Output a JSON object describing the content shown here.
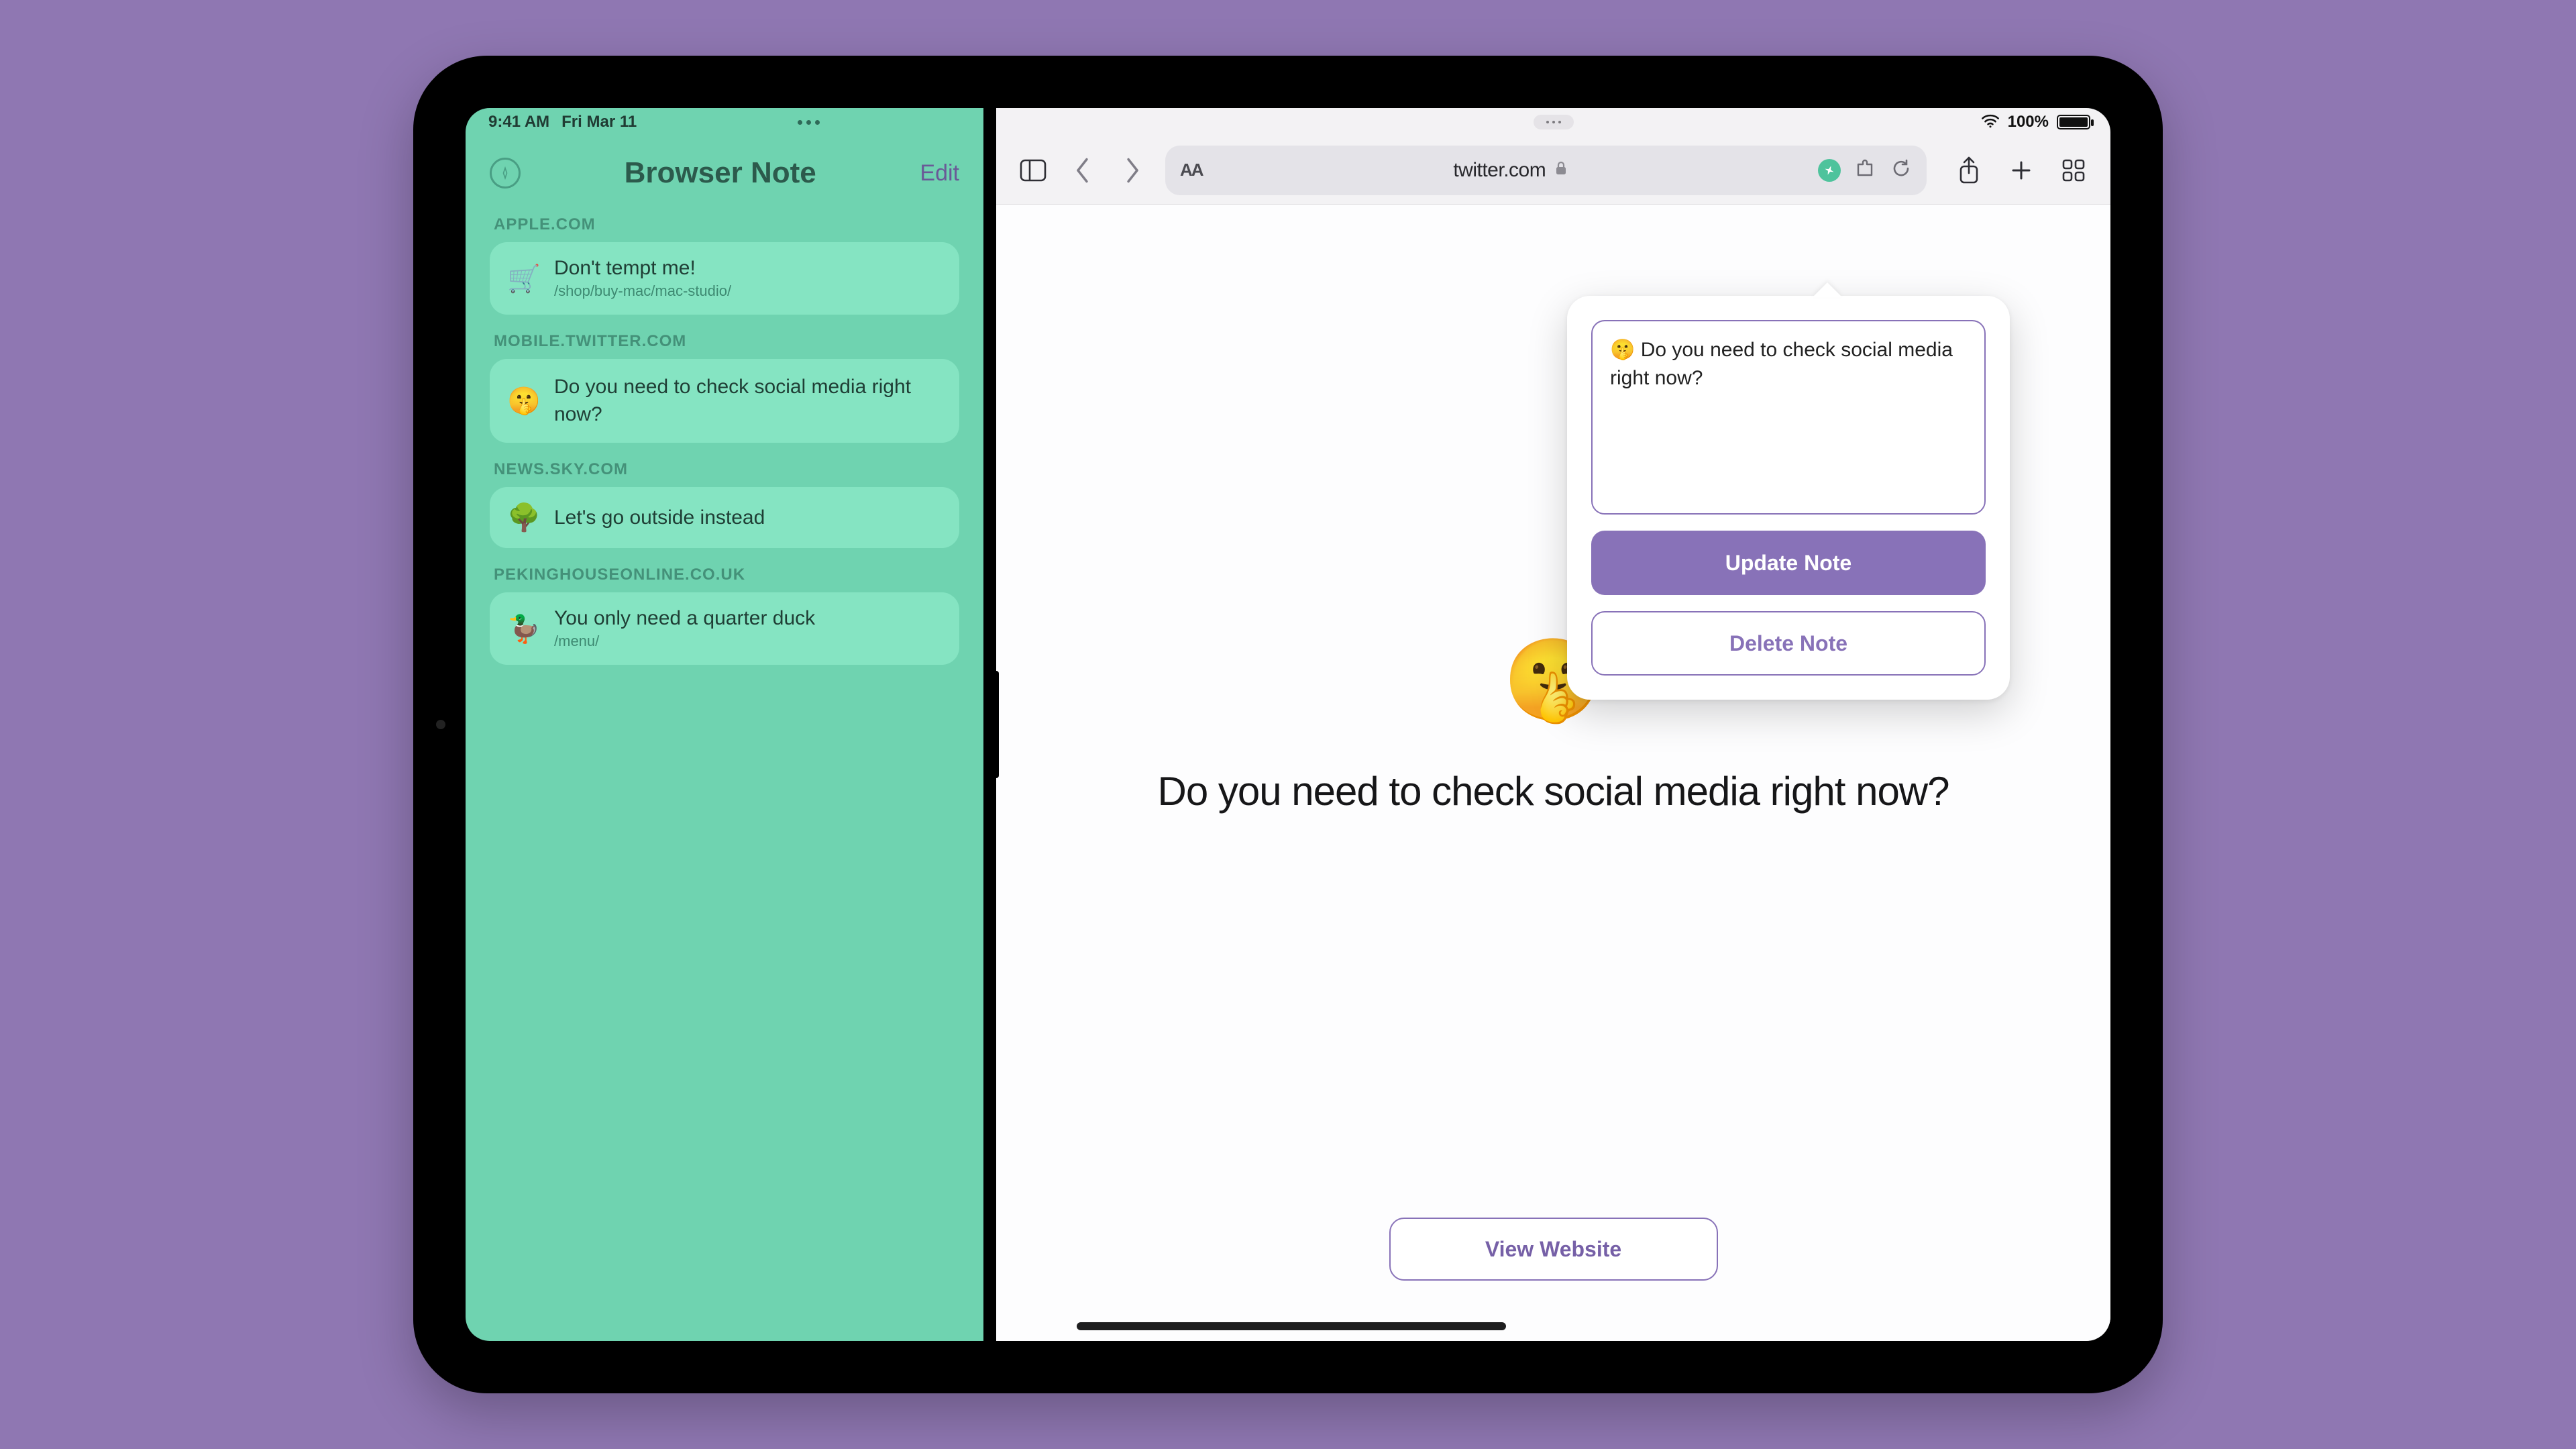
{
  "status": {
    "time": "9:41 AM",
    "date": "Fri Mar 11",
    "battery": "100%"
  },
  "left": {
    "title": "Browser Note",
    "edit_label": "Edit",
    "groups": [
      {
        "domain": "APPLE.COM",
        "emoji": "🛒",
        "title": "Don't tempt me!",
        "path": "/shop/buy-mac/mac-studio/"
      },
      {
        "domain": "MOBILE.TWITTER.COM",
        "emoji": "🤫",
        "title": "Do you need to check social media right now?",
        "path": ""
      },
      {
        "domain": "NEWS.SKY.COM",
        "emoji": "🌳",
        "title": "Let's go outside instead",
        "path": ""
      },
      {
        "domain": "PEKINGHOUSEONLINE.CO.UK",
        "emoji": "🦆",
        "title": "You only need a quarter duck",
        "path": "/menu/"
      }
    ]
  },
  "safari": {
    "url": "twitter.com",
    "aa": "AA"
  },
  "popover": {
    "text": "🤫 Do you need to check social media right now?",
    "update": "Update Note",
    "delete": "Delete Note"
  },
  "page": {
    "emoji": "🤫",
    "question": "Do you need to check social media right now?",
    "view_website": "View Website"
  }
}
